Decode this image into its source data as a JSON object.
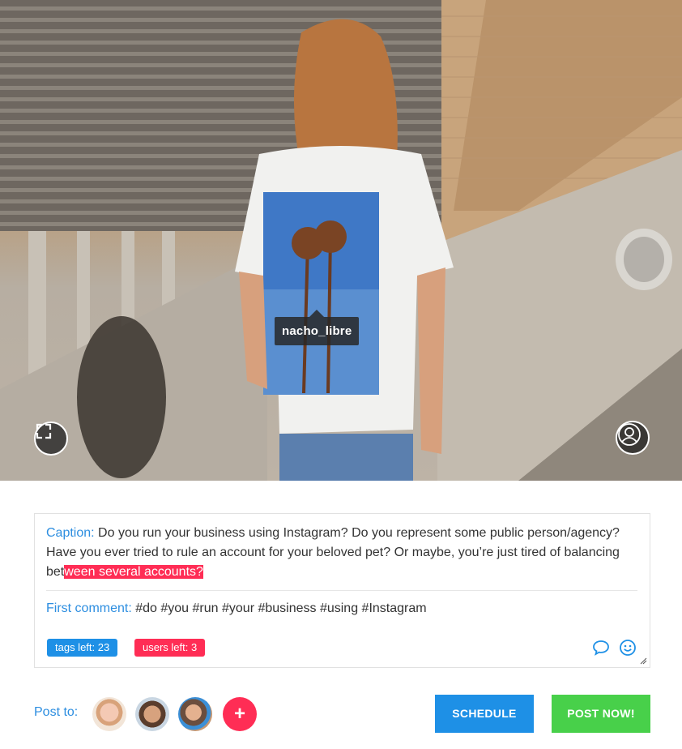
{
  "photo": {
    "tagged_user": "nacho_libre",
    "expand_icon": "expand-icon",
    "user_icon": "user-tag-icon"
  },
  "editor": {
    "caption_label": "Caption:",
    "caption_text": " Do you run your business using Instagram? Do you represent some public person/agency? Have you ever tried to rule an account for your beloved pet? Or maybe, you’re just tired of balancing bet",
    "caption_highlight": "ween several accounts?",
    "comment_label": "First comment:",
    "comment_text": " #do #you #run #your #business #using #Instagram",
    "tags_left": "tags left: 23",
    "users_left": "users left: 3",
    "comment_icon": "speech-bubble-icon",
    "emoji_icon": "smiley-icon"
  },
  "footer": {
    "post_to_label": "Post to:",
    "accounts": [
      "account-1",
      "account-2",
      "account-3"
    ],
    "add_label": "+",
    "schedule_label": "SCHEDULE",
    "post_now_label": "POST NOW!"
  },
  "colors": {
    "accent_blue": "#1e90e6",
    "accent_red": "#ff2d55",
    "accent_green": "#48d04a"
  }
}
